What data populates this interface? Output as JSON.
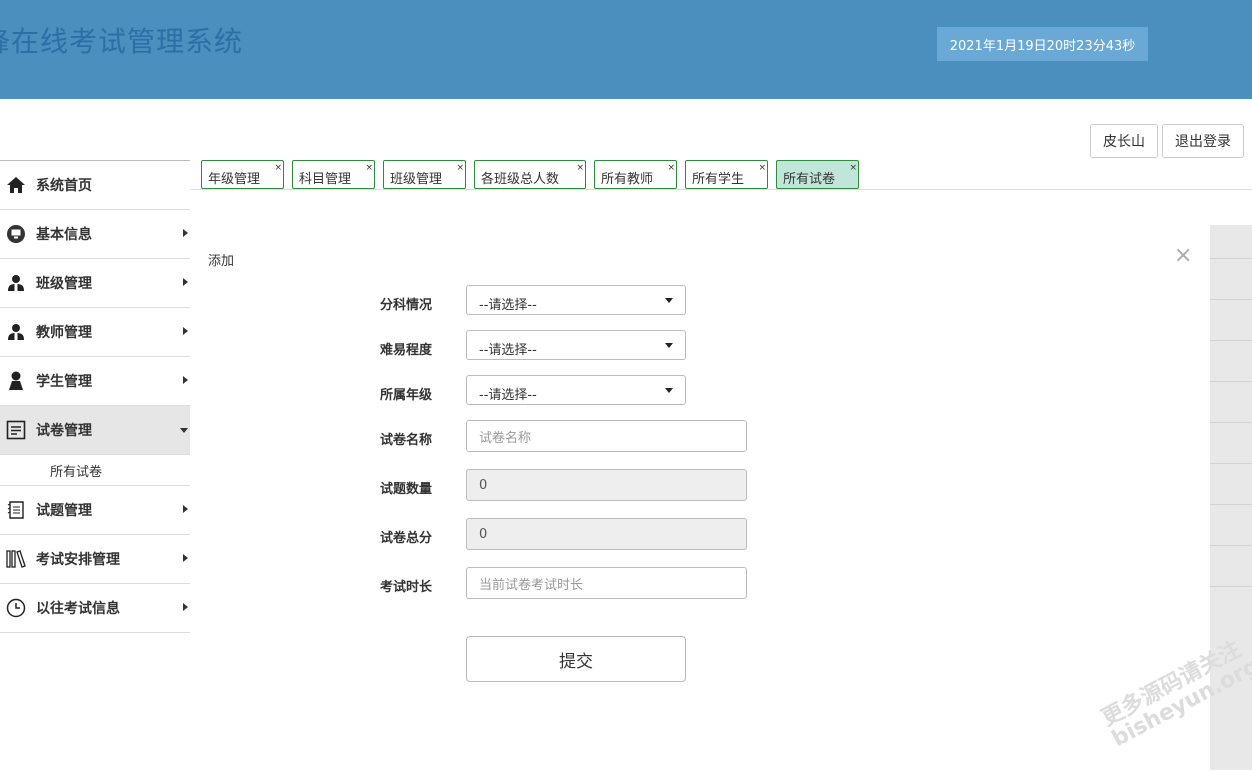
{
  "header": {
    "title": "锋在线考试管理系统",
    "datetime": "2021年1月19日20时23分43秒"
  },
  "user": {
    "name_button": "皮长山",
    "logout_button": "退出登录"
  },
  "sidebar": {
    "items": [
      {
        "label": "系统首页"
      },
      {
        "label": "基本信息"
      },
      {
        "label": "班级管理"
      },
      {
        "label": "教师管理"
      },
      {
        "label": "学生管理"
      },
      {
        "label": "试卷管理"
      },
      {
        "label": "试题管理"
      },
      {
        "label": "考试安排管理"
      },
      {
        "label": "以往考试信息"
      }
    ],
    "sub_item": "所有试卷"
  },
  "tabs": [
    {
      "label": "年级管理",
      "close": "×"
    },
    {
      "label": "科目管理",
      "close": "×"
    },
    {
      "label": "班级管理",
      "close": "×"
    },
    {
      "label": "各班级总人数",
      "close": "×"
    },
    {
      "label": "所有教师",
      "close": "×"
    },
    {
      "label": "所有学生",
      "close": "×"
    },
    {
      "label": "所有试卷",
      "close": "×"
    }
  ],
  "modal": {
    "title": "添加",
    "close": "×",
    "fields": {
      "subject": {
        "label": "分科情况",
        "value": "--请选择--"
      },
      "difficulty": {
        "label": "难易程度",
        "value": "--请选择--"
      },
      "grade": {
        "label": "所属年级",
        "value": "--请选择--"
      },
      "paper_name": {
        "label": "试卷名称",
        "placeholder": "试卷名称"
      },
      "question_count": {
        "label": "试题数量",
        "value": "0"
      },
      "total_score": {
        "label": "试卷总分",
        "value": "0"
      },
      "duration": {
        "label": "考试时长",
        "placeholder": "当前试卷考试时长"
      }
    },
    "submit": "提交"
  },
  "watermark": {
    "line1": "更多源码请关注",
    "line2": "bisheyun.org"
  },
  "colors": {
    "header_bg": "#4a8fbd",
    "clock_bg": "#6aa8d6",
    "tab_border": "#2e8b3d",
    "tab_active": "#bfe6d9"
  }
}
